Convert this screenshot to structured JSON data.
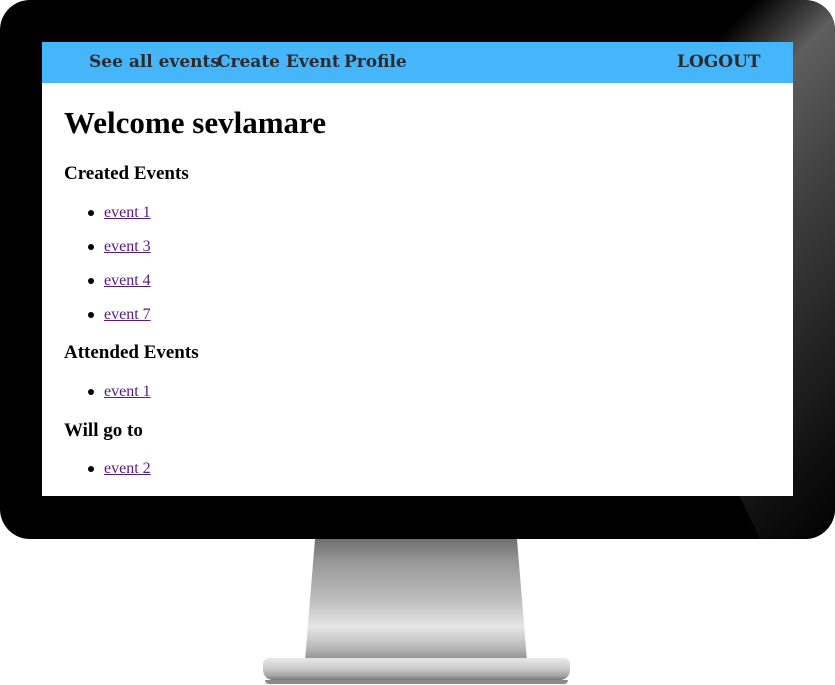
{
  "navbar": {
    "links": [
      "See all events",
      "Create Event",
      "Profile"
    ],
    "logout_label": "LOGOUT",
    "background": "#46b6fc"
  },
  "main": {
    "welcome": "Welcome sevlamare",
    "sections": [
      {
        "title": "Created Events",
        "events": [
          "event 1",
          "event 3",
          "event 4",
          "event 7"
        ]
      },
      {
        "title": "Attended Events",
        "events": [
          "event 1"
        ]
      },
      {
        "title": "Will go to",
        "events": [
          "event 2"
        ]
      }
    ]
  },
  "colors": {
    "link_visited": "#551a8b",
    "nav_text": "#2b2b2b"
  }
}
